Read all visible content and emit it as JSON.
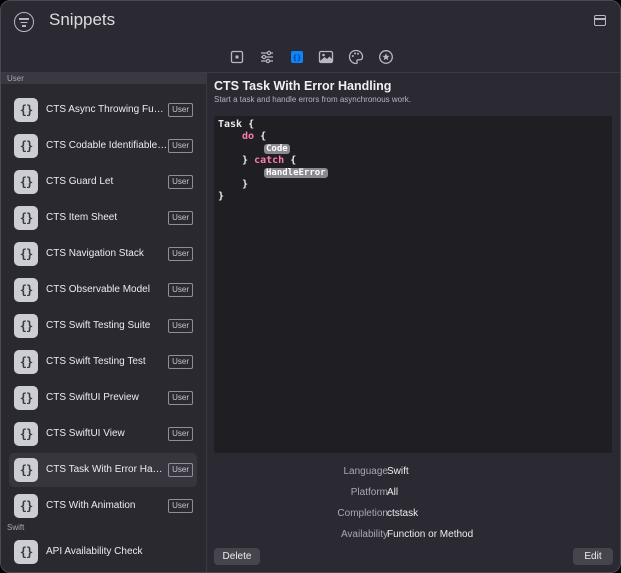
{
  "app": {
    "title": "Snippets"
  },
  "toolbar": {
    "icons": [
      "file-icon",
      "sliders-icon",
      "code-snippet-icon",
      "image-icon",
      "palette-icon",
      "star-icon"
    ],
    "selected": "code-snippet-icon",
    "accent": "#0a84ff"
  },
  "sidebar": {
    "sections": {
      "user": "User",
      "swift": "Swift"
    },
    "items": [
      {
        "label": "CTS Async Throwing Function",
        "badge": "User"
      },
      {
        "label": "CTS Codable Identifiable Struct",
        "badge": "User"
      },
      {
        "label": "CTS Guard Let",
        "badge": "User"
      },
      {
        "label": "CTS Item Sheet",
        "badge": "User"
      },
      {
        "label": "CTS Navigation Stack",
        "badge": "User"
      },
      {
        "label": "CTS Observable Model",
        "badge": "User"
      },
      {
        "label": "CTS Swift Testing Suite",
        "badge": "User"
      },
      {
        "label": "CTS Swift Testing Test",
        "badge": "User"
      },
      {
        "label": "CTS SwiftUI Preview",
        "badge": "User"
      },
      {
        "label": "CTS SwiftUI View",
        "badge": "User"
      },
      {
        "label": "CTS Task With Error Handling",
        "badge": "User"
      },
      {
        "label": "CTS With Animation",
        "badge": "User"
      },
      {
        "label": "API Availability Check",
        "badge": ""
      }
    ],
    "item_icon_text": "{}",
    "selected_index": 10
  },
  "detail": {
    "title": "CTS Task With Error Handling",
    "subtitle": "Start a task and handle errors from asynchronous work.",
    "code": {
      "task": "Task {",
      "do_kw": "do",
      "open_brace": "{",
      "placeholder_code": "Code",
      "close_brace_catch": "}",
      "catch_kw": "catch",
      "placeholder_handle": "HandleError",
      "close_inner": "}",
      "close_outer": "}"
    },
    "properties": [
      {
        "key": "Language",
        "value": "Swift"
      },
      {
        "key": "Platform",
        "value": "All"
      },
      {
        "key": "Completion",
        "value": "ctstask"
      },
      {
        "key": "Availability",
        "value": "Function or Method"
      }
    ],
    "delete_label": "Delete",
    "edit_label": "Edit"
  }
}
